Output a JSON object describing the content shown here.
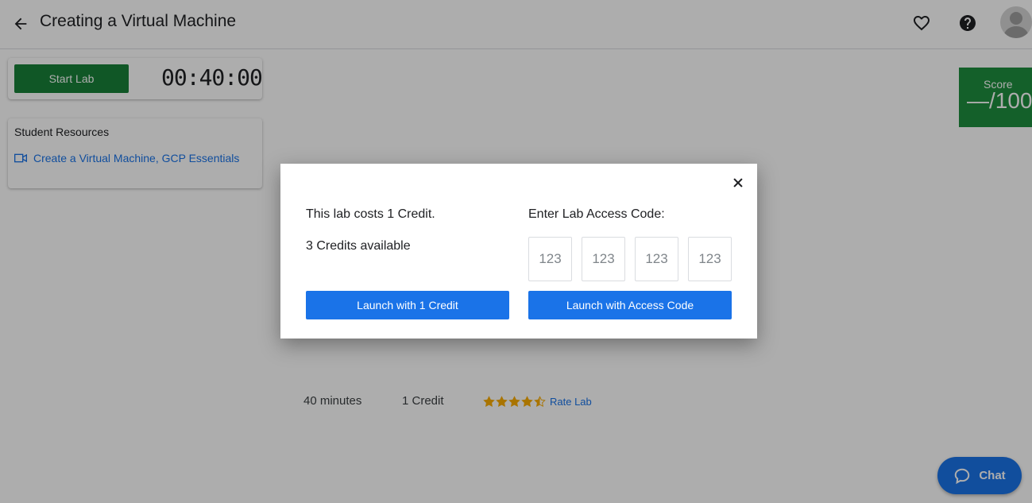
{
  "header": {
    "title": "Creating a Virtual Machine",
    "back_icon": "arrow-back-icon",
    "favorite_icon": "heart-icon",
    "help_icon": "help-circle-icon"
  },
  "lab_control": {
    "start_label": "Start Lab",
    "timer": "00:40:00"
  },
  "resources": {
    "title": "Student Resources",
    "link_label": "Create a Virtual Machine, GCP Essentials",
    "link_icon": "video-icon"
  },
  "score": {
    "label": "Score",
    "value": "—/100"
  },
  "meta": {
    "duration": "40 minutes",
    "cost": "1 Credit",
    "rating_stars": 4.5,
    "rate_label": "Rate Lab"
  },
  "chat": {
    "label": "Chat"
  },
  "dialog": {
    "cost_text": "This lab costs 1 Credit.",
    "available_text": "3 Credits available",
    "code_label": "Enter Lab Access Code:",
    "code_placeholders": [
      "123",
      "123",
      "123",
      "123"
    ],
    "launch_credit_label": "Launch with 1 Credit",
    "launch_code_label": "Launch with Access Code"
  },
  "colors": {
    "primary_blue": "#1a73e8",
    "start_green": "#188038",
    "score_green": "#1e8e3e",
    "star_gold": "#f9ab00"
  }
}
